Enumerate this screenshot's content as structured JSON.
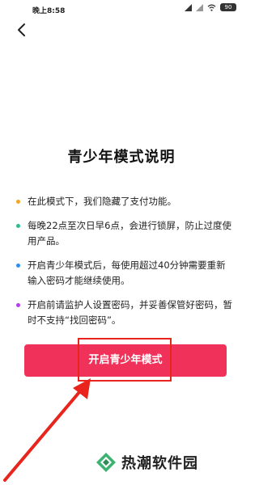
{
  "status_bar": {
    "time": "晚上8:58",
    "battery": "90"
  },
  "icons": {
    "back": "chevron-left-icon",
    "signal": "signal-icon",
    "wifi": "wifi-icon",
    "battery": "battery-icon"
  },
  "page": {
    "title": "青少年模式说明"
  },
  "rules": [
    {
      "text": "在此模式下，我们隐藏了支付功能。",
      "color": "#f5a623"
    },
    {
      "text": "每晚22点至次日早6点，会进行锁屏，防止过度使用产品。",
      "color": "#2dbf8a"
    },
    {
      "text": "开启青少年模式后，每使用超过40分钟需要重新输入密码才能继续使用。",
      "color": "#2f8ef4"
    },
    {
      "text": "开启前请监护人设置密码，并妥善保管好密码，暂时不支持“找回密码”。",
      "color": "#b63cf0"
    }
  ],
  "actions": {
    "enable_label": "开启青少年模式"
  },
  "annotation": {
    "highlight_color": "#e8241c"
  },
  "watermark": {
    "text": "热潮软件园"
  }
}
